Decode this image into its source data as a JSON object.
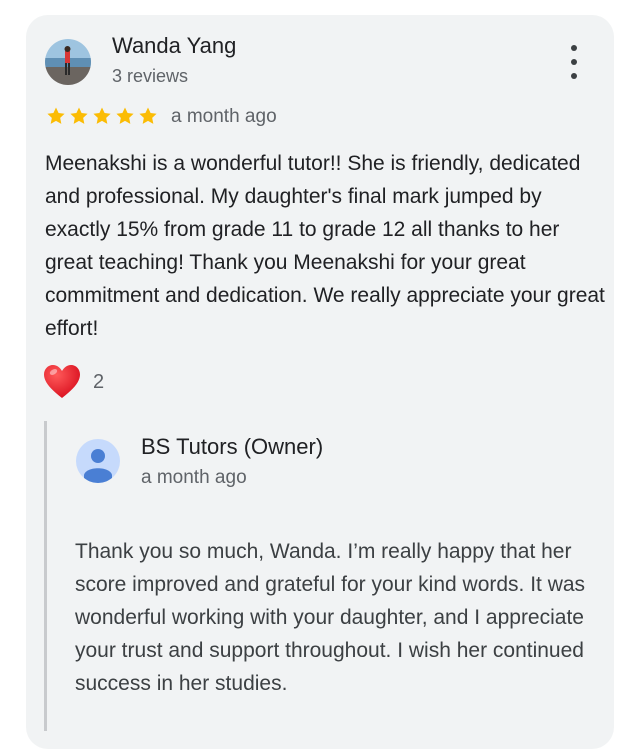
{
  "review": {
    "reviewer_name": "Wanda Yang",
    "review_count": "3 reviews",
    "rating": 5,
    "max_rating": 5,
    "time_ago": "a month ago",
    "text": "Meenakshi is a wonderful tutor!! She is friendly, dedicated and professional. My daughter's final mark jumped by exactly 15% from grade 11 to grade 12 all thanks to her great teaching! Thank you Meenakshi for your great commitment and dedication. We really appreciate your great effort!",
    "reaction_icon": "heart-icon",
    "reaction_count": "2",
    "star_color": "#fbbc04"
  },
  "reply": {
    "owner_name": "BS Tutors (Owner)",
    "time_ago": "a month ago",
    "text": "Thank you so much, Wanda. I’m really happy that her score improved and grateful for your kind words. It was wonderful working with your daughter, and I appreciate your trust and support throughout. I wish her continued success in her studies."
  }
}
